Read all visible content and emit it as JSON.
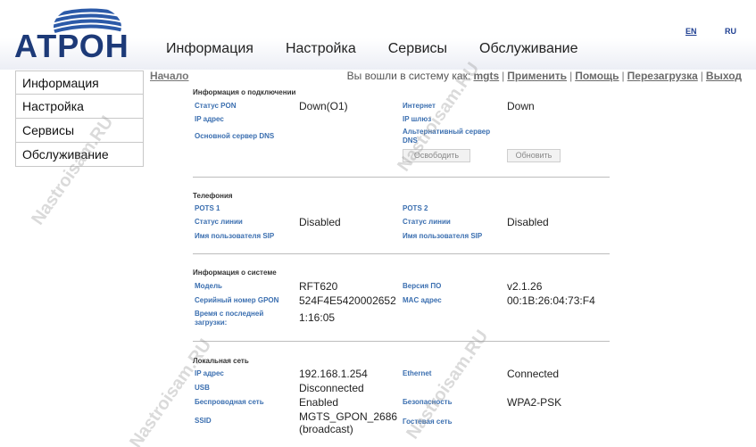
{
  "logo": {
    "text": "АТРОН"
  },
  "lang": {
    "en": "EN",
    "ru": "RU"
  },
  "topnav": [
    "Информация",
    "Настройка",
    "Сервисы",
    "Обслуживание"
  ],
  "sidebar": [
    "Информация",
    "Настройка",
    "Сервисы",
    "Обслуживание"
  ],
  "breadcrumb": "Начало",
  "userbar": {
    "prefix": "Вы вошли в систему как:",
    "user": "mgts",
    "links": [
      "Применить",
      "Помощь",
      "Перезагрузка",
      "Выход"
    ]
  },
  "connection": {
    "title": "Информация о подключении",
    "pon_status_label": "Статус PON",
    "pon_status_value": "Down(O1)",
    "ip_label": "IP адрес",
    "dns_primary_label": "Основной сервер DNS",
    "internet_label": "Интернет",
    "internet_value": "Down",
    "gateway_label": "IP шлюз",
    "dns_alt_label": "Альтернативный сервер DNS",
    "release_button": "Освободить",
    "renew_button": "Обновить"
  },
  "telephony": {
    "title": "Телефония",
    "pots1": "POTS 1",
    "pots2": "POTS 2",
    "line_status_label": "Статус линии",
    "line1_status": "Disabled",
    "line2_status": "Disabled",
    "sip_user_label": "Имя пользователя SIP"
  },
  "system": {
    "title": "Информация о системе",
    "model_label": "Модель",
    "model_value": "RFT620",
    "serial_label": "Серийный номер GPON",
    "serial_value": "524F4E5420002652",
    "uptime_label": "Время с последней загрузки:",
    "uptime_value": "1:16:05",
    "fw_label": "Версия ПО",
    "fw_value": "v2.1.26",
    "mac_label": "MAC адрес",
    "mac_value": "00:1B:26:04:73:F4"
  },
  "lan": {
    "title": "Локальная сеть",
    "ip_label": "IP адрес",
    "ip_value": "192.168.1.254",
    "usb_label": "USB",
    "usb_value": "Disconnected",
    "wifi_label": "Беспроводная сеть",
    "wifi_value": "Enabled",
    "ssid_label": "SSID",
    "ssid_value": "MGTS_GPON_2686",
    "ssid_note": "(broadcast)",
    "ethernet_label": "Ethernet",
    "ethernet_value": "Connected",
    "security_label": "Безопасность",
    "security_value": "WPA2-PSK",
    "guest_label": "Гостевая сеть"
  },
  "watermark": "Nastroisam.RU"
}
